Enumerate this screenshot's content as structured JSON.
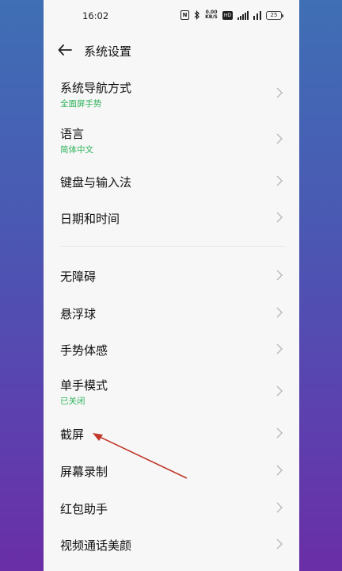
{
  "status_bar": {
    "time": "16:02",
    "nfc": "N",
    "speed_value": "0.00",
    "speed_unit": "KB/S",
    "hd_badge": "HD",
    "battery": "25"
  },
  "header": {
    "title": "系统设置"
  },
  "rows": [
    {
      "label": "系统导航方式",
      "sub": "全面屏手势"
    },
    {
      "label": "语言",
      "sub": "简体中文"
    },
    {
      "label": "键盘与输入法"
    },
    {
      "label": "日期和时间"
    },
    {
      "label": "无障碍"
    },
    {
      "label": "悬浮球"
    },
    {
      "label": "手势体感"
    },
    {
      "label": "单手模式",
      "sub": "已关闭"
    },
    {
      "label": "截屏"
    },
    {
      "label": "屏幕录制"
    },
    {
      "label": "红包助手"
    },
    {
      "label": "视频通话美颜"
    }
  ],
  "colors": {
    "accent_green": "#2fb35a",
    "annotation_arrow": "#c0392b"
  }
}
